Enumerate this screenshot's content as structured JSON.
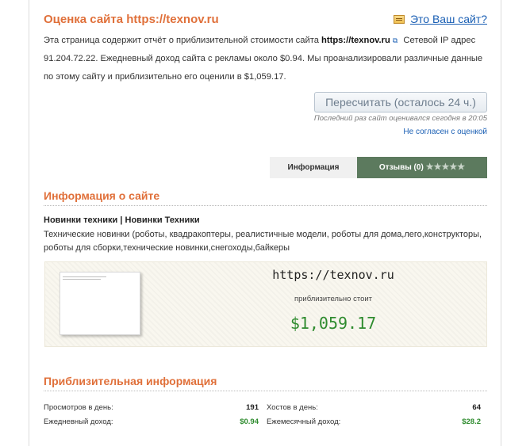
{
  "header": {
    "title": "Оценка сайта https://texnov.ru",
    "owner_link": "Это Ваш сайт?"
  },
  "description": {
    "part1": "Эта страница содержит отчёт о приблизительной стоимости сайта ",
    "site": "https://texnov.ru",
    "part2": " Сетевой IP адрес 91.204.72.22. Ежедневный доход сайта с рекламы около $0.94. Мы проанализировали различные данные по этому сайту и приблизительно его оценили в $1,059.17."
  },
  "recalc": {
    "button_label": "Пересчитать (осталось 24 ч.)",
    "last_evaluated": "Последний раз сайт оценивался сегодня в 20:05",
    "disagree_link": "Не согласен с оценкой"
  },
  "tabs": {
    "info": "Информация",
    "reviews": "Отзывы (0)",
    "stars": "★★★★★"
  },
  "site_info": {
    "section_title": "Информация о сайте",
    "site_title": "Новинки техники | Новинки Техники",
    "site_description": "Технические новинки (роботы, квадракоптеры, реалистичные модели, роботы для дома,лего,конструкторы, роботы для сборки,технические новинки,снегоходы,байкеры"
  },
  "valuation": {
    "domain": "https://texnov.ru",
    "approx_label": "приблизительно стоит",
    "price": "$1,059.17"
  },
  "approx_info": {
    "section_title": "Приблизительная информация",
    "rows": [
      {
        "label_left": "Просмотров в день:",
        "value_left": "191",
        "label_right": "Хостов в день:",
        "value_right": "64"
      },
      {
        "label_left": "Ежедневный доход:",
        "value_left": "$0.94",
        "label_right": "Ежемесячный доход:",
        "value_right": "$28.2"
      }
    ]
  },
  "colors": {
    "accent": "#e0703a",
    "link": "#1a5fb4",
    "money": "#2e8b2e",
    "reviews_tab": "#5c7a5e"
  }
}
